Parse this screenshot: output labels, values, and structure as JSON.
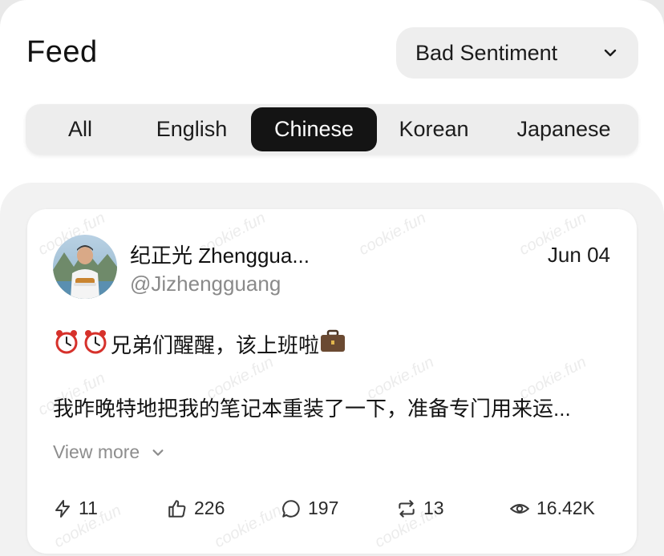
{
  "header": {
    "title": "Feed",
    "filter": {
      "selected": "Bad Sentiment",
      "icon": "chevron-down-icon"
    }
  },
  "tabs": [
    {
      "label": "All",
      "active": false
    },
    {
      "label": "English",
      "active": false
    },
    {
      "label": "Chinese",
      "active": true
    },
    {
      "label": "Korean",
      "active": false
    },
    {
      "label": "Japanese",
      "active": false
    }
  ],
  "post": {
    "author_name": "纪正光 Zhenggua...",
    "handle": "@Jizhengguang",
    "date": "Jun 04",
    "text_line1": "兄弟们醒醒，该上班啦",
    "text_line2": "我昨晚特地把我的笔记本重装了一下，准备专门用来运...",
    "view_more": "View more",
    "stats": {
      "score": "11",
      "likes": "226",
      "comments": "197",
      "reposts": "13",
      "views": "16.42K"
    }
  },
  "watermark": "cookie.fun",
  "colors": {
    "active_tab_bg": "#141414",
    "active_tab_text": "#ffffff",
    "muted_text": "#8a8a8a"
  }
}
